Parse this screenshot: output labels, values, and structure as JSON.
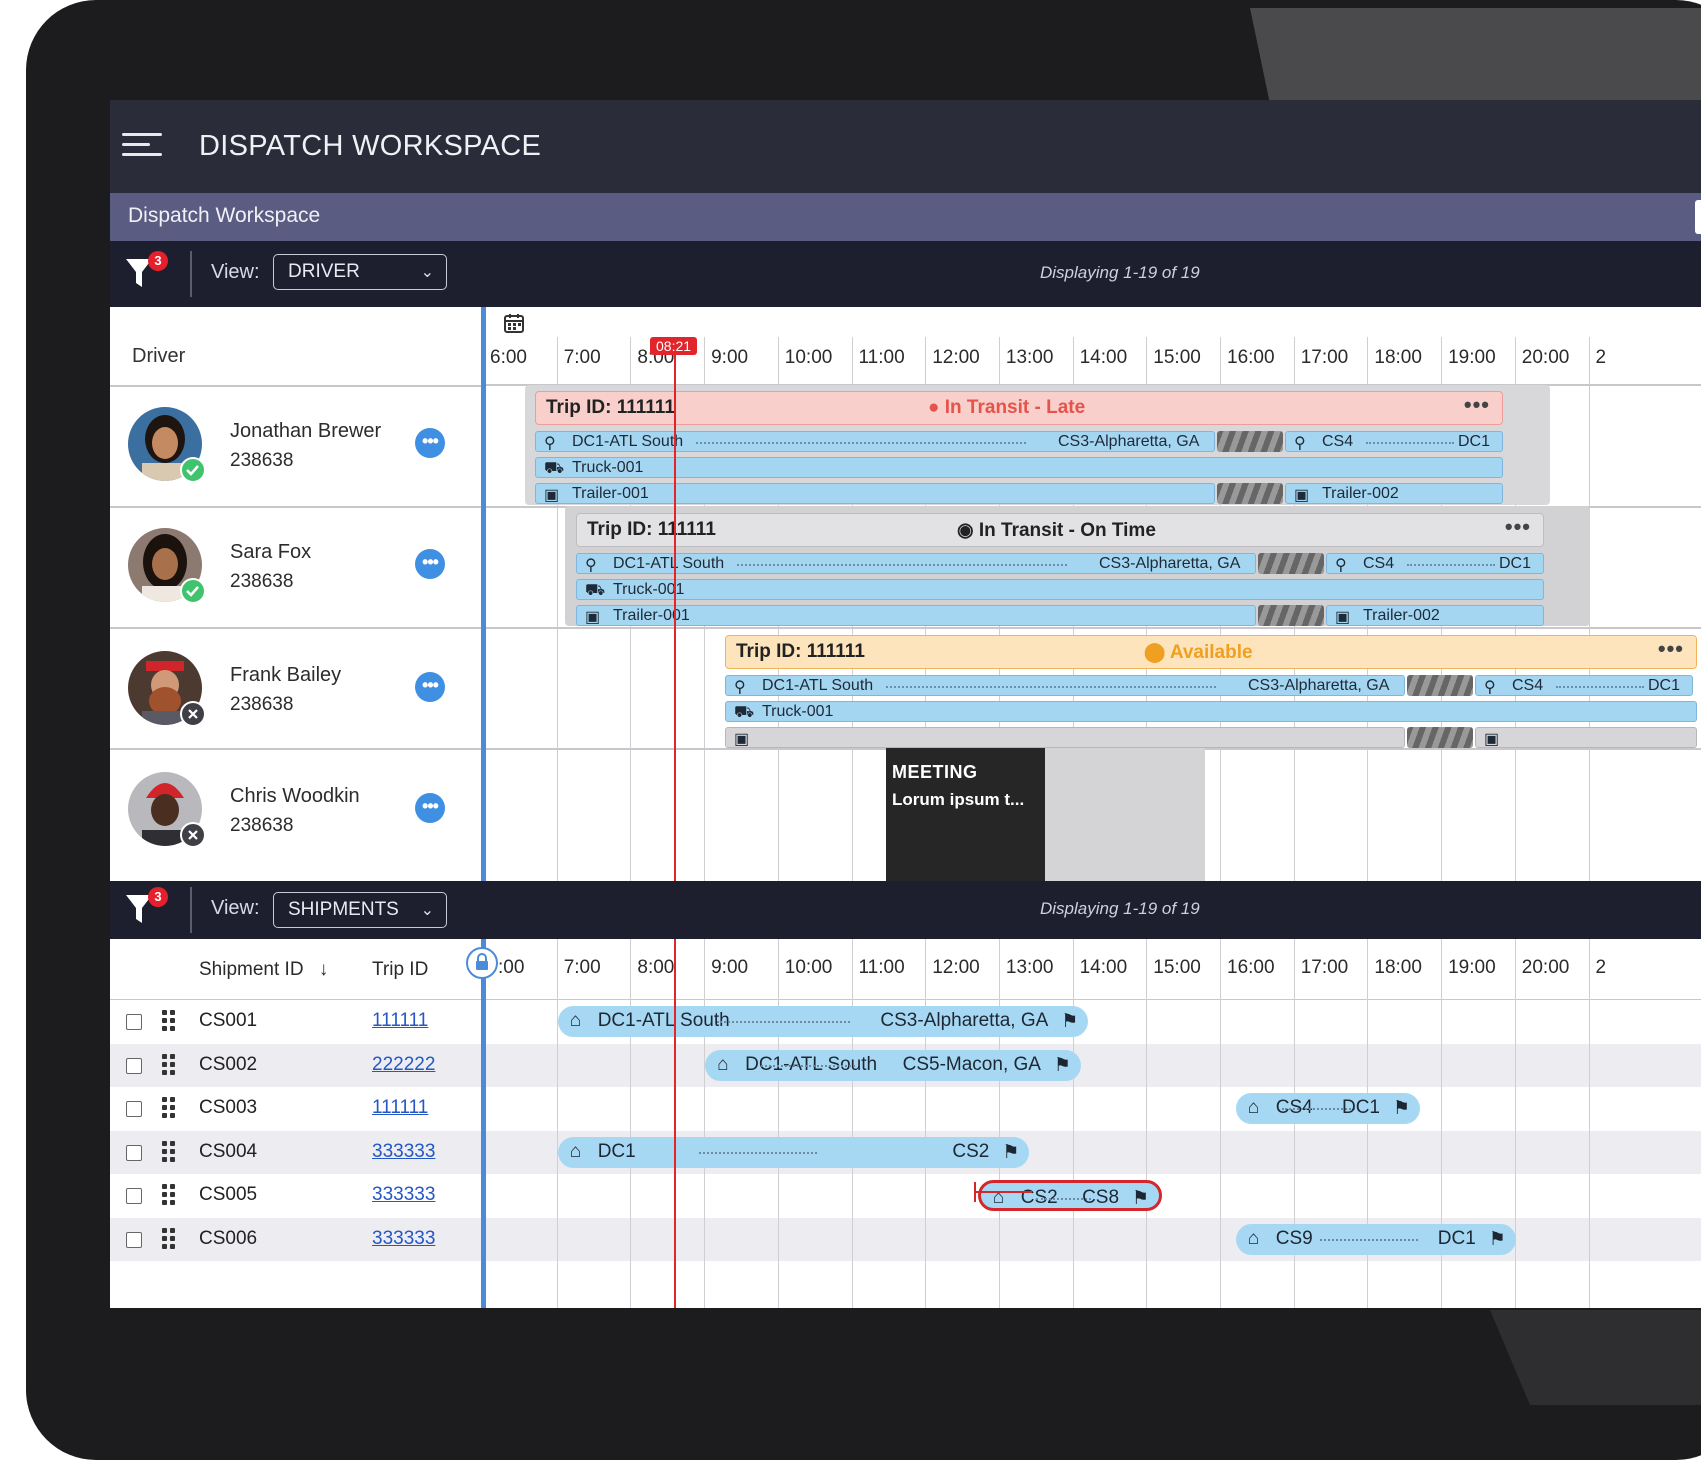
{
  "app": {
    "title": "DISPATCH WORKSPACE",
    "breadcrumb": "Dispatch Workspace"
  },
  "drivers_panel": {
    "filter_badge": "3",
    "view_label": "View:",
    "view_value": "DRIVER",
    "displaying": "Displaying 1-19 of 19",
    "column_label": "Driver",
    "now_time": "08:21",
    "hours": [
      "6:00",
      "7:00",
      "8:00",
      "9:00",
      "10:00",
      "11:00",
      "12:00",
      "13:00",
      "14:00",
      "15:00",
      "16:00",
      "17:00",
      "18:00",
      "19:00",
      "20:00",
      "2"
    ],
    "rows": [
      {
        "name": "Jonathan Brewer",
        "id": "238638",
        "status": "ok",
        "trip": {
          "label": "Trip ID:",
          "id": "111111",
          "status": "In Transit - Late",
          "color": "#f8c9c6",
          "status_color": "#e5534b",
          "route_from": "DC1-ATL South",
          "route_to": "CS3-Alpharetta, GA",
          "route2_from": "CS4",
          "route2_to": "DC1",
          "truck": "Truck-001",
          "trailer": "Trailer-001",
          "trailer2": "Trailer-002"
        }
      },
      {
        "name": "Sara Fox",
        "id": "238638",
        "status": "ok",
        "trip": {
          "label": "Trip ID:",
          "id": "111111",
          "status": "In Transit - On Time",
          "color": "#d4d4d6",
          "status_color": "#222222",
          "route_from": "DC1-ATL South",
          "route_to": "CS3-Alpharetta, GA",
          "route2_from": "CS4",
          "route2_to": "DC1",
          "truck": "Truck-001",
          "trailer": "Trailer-001",
          "trailer2": "Trailer-002"
        }
      },
      {
        "name": "Frank Bailey",
        "id": "238638",
        "status": "off",
        "trip": {
          "label": "Trip ID:",
          "id": "111111",
          "status": "Available",
          "color": "#fde2b8",
          "status_color": "#f0a020",
          "route_from": "DC1-ATL South",
          "route_to": "CS3-Alpharetta, GA",
          "route2_from": "CS4",
          "route2_to": "DC1",
          "truck": "Truck-001"
        }
      },
      {
        "name": "Chris Woodkin",
        "id": "238638",
        "status": "off",
        "meeting": {
          "title": "MEETING",
          "text": "Lorum ipsum t..."
        }
      }
    ]
  },
  "shipments_panel": {
    "filter_badge": "3",
    "view_label": "View:",
    "view_value": "SHIPMENTS",
    "displaying": "Displaying 1-19 of 19",
    "col_shipment": "Shipment ID",
    "sort_arrow": "↓",
    "col_trip": "Trip ID",
    "hours": [
      ":00",
      "7:00",
      "8:00",
      "9:00",
      "10:00",
      "11:00",
      "12:00",
      "13:00",
      "14:00",
      "15:00",
      "16:00",
      "17:00",
      "18:00",
      "19:00",
      "20:00",
      "2"
    ],
    "rows": [
      {
        "shipment": "CS001",
        "trip": "111111",
        "from": "DC1-ATL South",
        "to": "CS3-Alpharetta, GA"
      },
      {
        "shipment": "CS002",
        "trip": "222222",
        "from": "DC1-ATL South",
        "to": "CS5-Macon, GA"
      },
      {
        "shipment": "CS003",
        "trip": "111111",
        "from": "CS4",
        "to": "DC1"
      },
      {
        "shipment": "CS004",
        "trip": "333333",
        "from": "DC1",
        "to": "CS2"
      },
      {
        "shipment": "CS005",
        "trip": "333333",
        "from": "CS2",
        "to": "CS8"
      },
      {
        "shipment": "CS006",
        "trip": "333333",
        "from": "CS9",
        "to": "DC1"
      }
    ]
  }
}
